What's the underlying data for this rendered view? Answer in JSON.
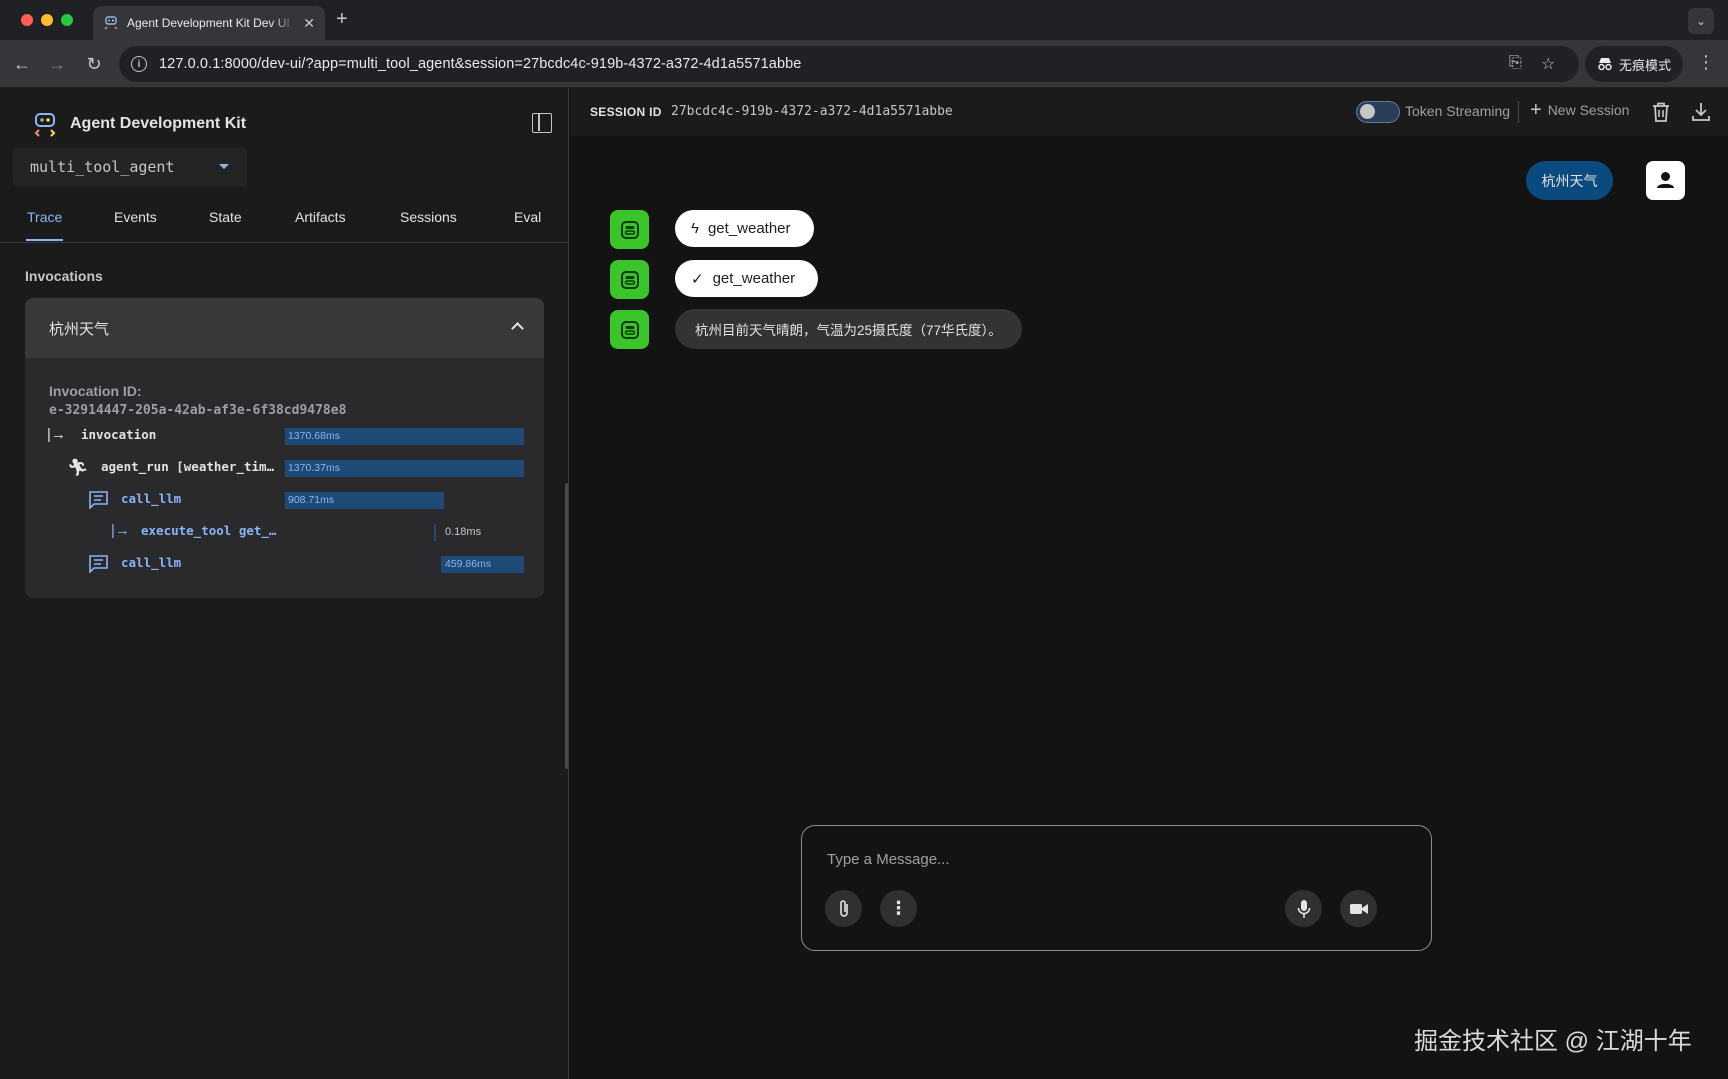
{
  "browser": {
    "tab_title": "Agent Development Kit Dev UI",
    "url": "127.0.0.1:8000/dev-ui/?app=multi_tool_agent&session=27bcdc4c-919b-4372-a372-4d1a5571abbe",
    "incognito_label": "无痕模式"
  },
  "sidebar": {
    "brand_title": "Agent Development Kit",
    "agent_select": "multi_tool_agent",
    "tabs": [
      "Trace",
      "Events",
      "State",
      "Artifacts",
      "Sessions",
      "Eval"
    ],
    "active_tab": "Trace",
    "section_title": "Invocations",
    "invocation": {
      "title": "杭州天气",
      "id_label": "Invocation ID:",
      "id": "e-32914447-205a-42ab-af3e-6f38cd9478e8",
      "spans": [
        {
          "name": "invocation",
          "duration": "1370.68ms"
        },
        {
          "name": "agent_run [weather_tim…",
          "duration": "1370.37ms"
        },
        {
          "name": "call_llm",
          "duration": "908.71ms"
        },
        {
          "name": "execute_tool get_…",
          "duration": "0.18ms"
        },
        {
          "name": "call_llm",
          "duration": "459.86ms"
        }
      ]
    }
  },
  "main": {
    "session_label": "SESSION ID",
    "session_id": "27bcdc4c-919b-4372-a372-4d1a5571abbe",
    "token_streaming_label": "Token Streaming",
    "token_streaming_on": false,
    "new_session_label": "New Session",
    "messages": {
      "user": "杭州天气",
      "tool_call": "get_weather",
      "tool_response": "get_weather",
      "bot": "杭州目前天气晴朗，气温为25摄氏度（77华氏度）。"
    },
    "composer_placeholder": "Type a Message..."
  },
  "watermark": "掘金技术社区 @ 江湖十年",
  "colors": {
    "accent": "#8ab4f8",
    "bot_avatar": "#3cc52a",
    "user_bubble": "#0b4a7e",
    "trace_bar": "#1e4a75"
  }
}
